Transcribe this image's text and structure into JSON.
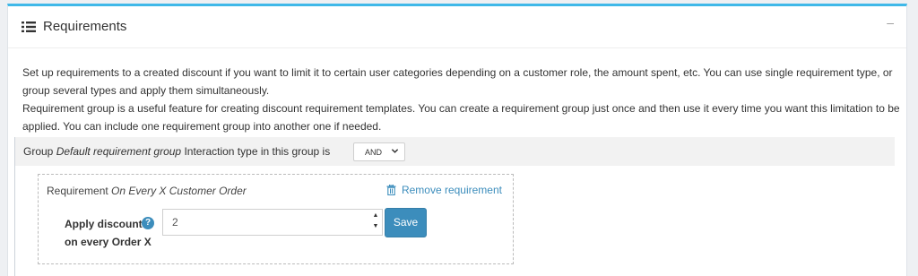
{
  "card": {
    "title": "Requirements",
    "title_icon": "list-icon",
    "collapse_glyph": "–"
  },
  "description": {
    "line1": "Set up requirements to a created discount if you want to limit it to certain user categories depending on a customer role, the amount spent, etc. You can use single requirement type, or group several types and apply them simultaneously.",
    "line2": "Requirement group is a useful feature for creating discount requirement templates. You can create a requirement group just once and then use it every time you want this limitation to be applied. You can include one requirement group into another one if needed."
  },
  "group": {
    "prefix": "Group ",
    "name": "Default requirement group",
    "interaction_label": " Interaction type in this group is",
    "interaction_value": "AND"
  },
  "requirement": {
    "prefix": "Requirement ",
    "name": "On Every X Customer Order",
    "remove_label": "Remove requirement",
    "field_label_line1": "Apply discount",
    "field_label_line2": "on every Order X",
    "help_glyph": "?",
    "value": "2",
    "save_label": "Save"
  },
  "colors": {
    "accent": "#3c8dbc",
    "header_border": "#3fb8e8"
  }
}
